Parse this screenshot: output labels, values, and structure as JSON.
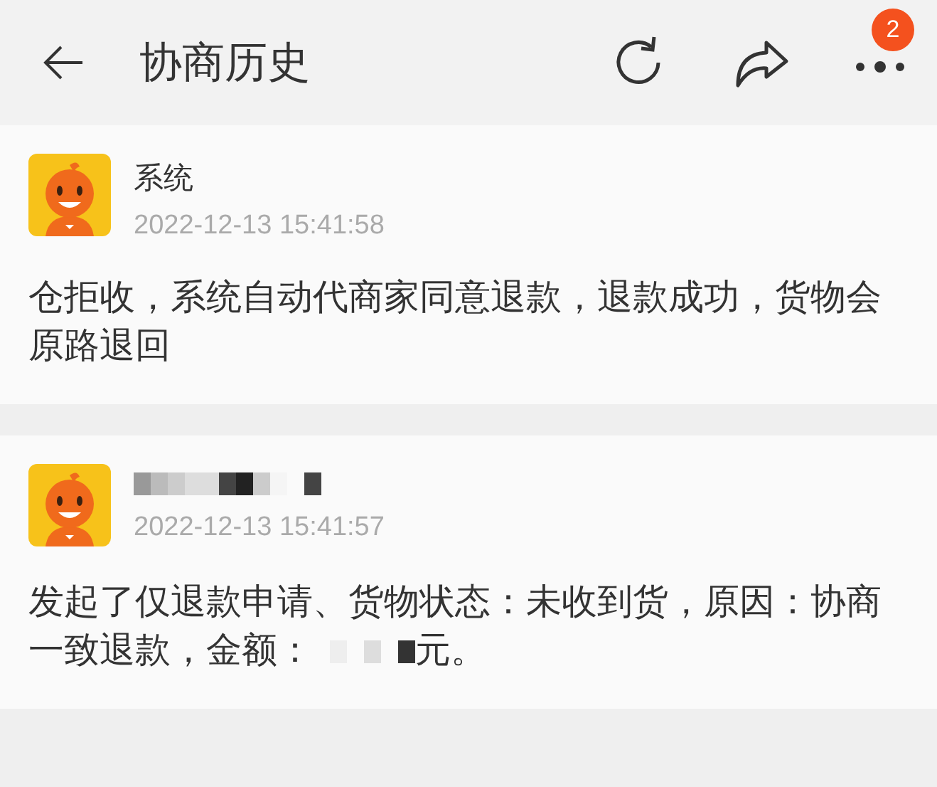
{
  "header": {
    "title": "协商历史",
    "badge": "2"
  },
  "records": [
    {
      "kind": "named",
      "sender": "系统",
      "time": "2022-12-13 15:41:58",
      "body": "仓拒收，系统自动代商家同意退款，退款成功，货物会原路退回"
    },
    {
      "kind": "redacted",
      "time": "2022-12-13 15:41:57",
      "body": "发起了仅退款申请、货物状态：未收到货，原因：协商一致退款，金额：",
      "body_tail": "元。"
    }
  ]
}
